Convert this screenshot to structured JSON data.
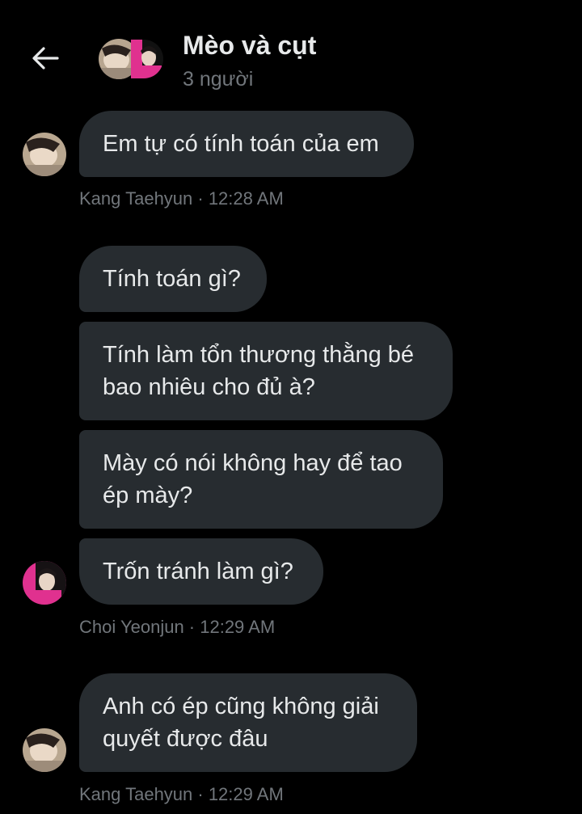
{
  "header": {
    "back_label": "Back",
    "title": "Mèo và cụt",
    "subtitle": "3 người"
  },
  "messages": [
    {
      "lines": [
        "Em tự có tính toán của em"
      ],
      "sender": "Kang Taehyun",
      "time": "12:28 AM",
      "avatar": "taehyun"
    },
    {
      "lines": [
        "Tính toán gì?"
      ],
      "sender": "",
      "time": "",
      "avatar": ""
    },
    {
      "lines": [
        "Tính làm tổn thương thằng bé",
        "bao nhiêu cho đủ à?"
      ],
      "sender": "",
      "time": "",
      "avatar": ""
    },
    {
      "lines": [
        "Mày có nói không hay để tao",
        "ép mày?"
      ],
      "sender": "",
      "time": "",
      "avatar": ""
    },
    {
      "lines": [
        "Trốn tránh làm gì?"
      ],
      "sender": "Choi Yeonjun",
      "time": "12:29 AM",
      "avatar": "yeonjun"
    },
    {
      "lines": [
        "Anh có ép cũng không giải",
        "quyết được đâu"
      ],
      "sender": "Kang Taehyun",
      "time": "12:29 AM",
      "avatar": "taehyun"
    }
  ],
  "meta": {
    "taehyun_1228": "Kang Taehyun · 12:28 AM",
    "yeonjun_1229": "Choi Yeonjun · 12:29 AM",
    "taehyun_1229": "Kang Taehyun · 12:29 AM"
  },
  "colors": {
    "background": "#000000",
    "bubble": "#272c30",
    "text": "#e7e9ea",
    "muted": "#71767b",
    "accent_pink": "#e0318f"
  }
}
